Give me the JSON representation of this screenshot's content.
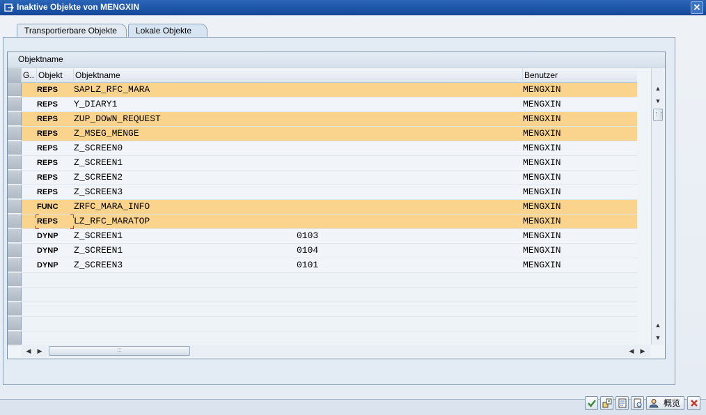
{
  "window": {
    "title": "Inaktive Objekte von MENGXIN",
    "close_symbol": "✕"
  },
  "tabs": [
    {
      "label": "Transportierbare Objekte",
      "active": false
    },
    {
      "label": "Lokale Objekte",
      "active": true
    }
  ],
  "grid": {
    "caption": "Objektname",
    "columns": [
      "G..",
      "Objekt",
      "Objektname",
      "Benutzer"
    ],
    "rows": [
      {
        "objekt": "REPS",
        "name": "SAPLZ_RFC_MARA",
        "num": "",
        "user": "MENGXIN",
        "highlight": true
      },
      {
        "objekt": "REPS",
        "name": "Y_DIARY1",
        "num": "",
        "user": "MENGXIN",
        "highlight": false
      },
      {
        "objekt": "REPS",
        "name": "ZUP_DOWN_REQUEST",
        "num": "",
        "user": "MENGXIN",
        "highlight": true
      },
      {
        "objekt": "REPS",
        "name": "Z_MSEG_MENGE",
        "num": "",
        "user": "MENGXIN",
        "highlight": true
      },
      {
        "objekt": "REPS",
        "name": "Z_SCREEN0",
        "num": "",
        "user": "MENGXIN",
        "highlight": false
      },
      {
        "objekt": "REPS",
        "name": "Z_SCREEN1",
        "num": "",
        "user": "MENGXIN",
        "highlight": false
      },
      {
        "objekt": "REPS",
        "name": "Z_SCREEN2",
        "num": "",
        "user": "MENGXIN",
        "highlight": false
      },
      {
        "objekt": "REPS",
        "name": "Z_SCREEN3",
        "num": "",
        "user": "MENGXIN",
        "highlight": false
      },
      {
        "objekt": "FUNC",
        "name": "ZRFC_MARA_INFO",
        "num": "",
        "user": "MENGXIN",
        "highlight": true
      },
      {
        "objekt": "REPS",
        "name": "LZ_RFC_MARATOP",
        "num": "",
        "user": "MENGXIN",
        "highlight": true
      },
      {
        "objekt": "DYNP",
        "name": "Z_SCREEN1",
        "num": "0103",
        "user": "MENGXIN",
        "highlight": false
      },
      {
        "objekt": "DYNP",
        "name": "Z_SCREEN1",
        "num": "0104",
        "user": "MENGXIN",
        "highlight": false
      },
      {
        "objekt": "DYNP",
        "name": "Z_SCREEN3",
        "num": "0101",
        "user": "MENGXIN",
        "highlight": false
      }
    ],
    "empty_rows": 5
  },
  "footer": {
    "buttons": [
      {
        "name": "confirm-button",
        "icon": "check-icon",
        "label": ""
      },
      {
        "name": "activate-button",
        "icon": "activate-icon",
        "label": ""
      },
      {
        "name": "display-button",
        "icon": "display-icon",
        "label": ""
      },
      {
        "name": "detail-button",
        "icon": "detail-icon",
        "label": ""
      },
      {
        "name": "overview-button",
        "icon": "user-icon",
        "label": "概览"
      },
      {
        "name": "cancel-button",
        "icon": "cancel-icon",
        "label": ""
      }
    ]
  },
  "colors": {
    "highlight_row": "#fad48c",
    "title_bar": "#1c55a8",
    "check_green": "#2e8b2e",
    "cancel_red": "#c0392b"
  }
}
